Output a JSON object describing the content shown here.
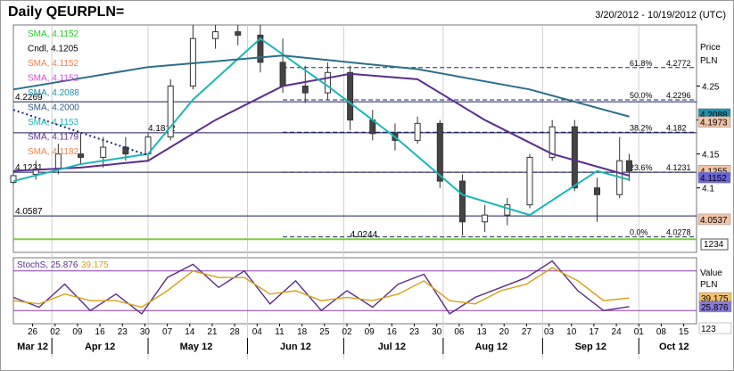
{
  "header": {
    "title": "Daily QEURPLN=",
    "date_range": "3/20/2012 - 10/19/2012 (UTC)"
  },
  "chart_data": [
    {
      "type": "line",
      "title": "Daily QEURPLN=",
      "y_axis": {
        "title": "Price",
        "unit": "PLN",
        "ticks": [
          4.25,
          4.2,
          4.15,
          4.1
        ],
        "range": [
          4.005,
          4.34
        ]
      },
      "x_axis": {
        "start": "2012-03-20",
        "end": "2012-10-19",
        "day_ticks": [
          "26",
          "02",
          "09",
          "16",
          "23",
          "30",
          "07",
          "14",
          "21",
          "28",
          "04",
          "11",
          "18",
          "25",
          "02",
          "09",
          "16",
          "23",
          "30",
          "06",
          "13",
          "20",
          "27",
          "03",
          "10",
          "17",
          "24",
          "01",
          "08",
          "15"
        ],
        "month_labels": [
          "Mar 12",
          "Apr 12",
          "May 12",
          "Jun 12",
          "Jul 12",
          "Aug 12",
          "Sep 12",
          "Oct 12"
        ]
      },
      "legend": [
        {
          "label": "SMA, 4.1152",
          "color": "#22c722"
        },
        {
          "label": "Cndl, 4.1205",
          "color": "#000000"
        },
        {
          "label": "SMA, 4.1152",
          "color": "#e8864f"
        },
        {
          "label": "SMA, 4.1152",
          "color": "#d14ad1"
        },
        {
          "label": "SMA, 4.2088",
          "color": "#1f8fa8"
        },
        {
          "label": "SMA, 4.2000",
          "color": "#2a5a86"
        },
        {
          "label": "SMA, 4.1153",
          "color": "#1ab6b6"
        },
        {
          "label": "SMA, 4.1179",
          "color": "#5a2e8a"
        },
        {
          "label": "SMA, 4.1182",
          "color": "#e8864f"
        }
      ],
      "fibonacci": [
        {
          "label": "61.8%",
          "value": "4.2772"
        },
        {
          "label": "50.0%",
          "value": "4.2296"
        },
        {
          "label": "38.2%",
          "value": "4.182"
        },
        {
          "label": "23.6%",
          "value": "4.1231"
        },
        {
          "label": "0.0%",
          "value": "4.0278"
        }
      ],
      "horizontal_levels": [
        {
          "label": "4.2269",
          "value": 4.2269
        },
        {
          "label": "4.1812",
          "value": 4.1812
        },
        {
          "label": "4.1231",
          "value": 4.1231
        },
        {
          "label": "4.0587",
          "value": 4.0587
        },
        {
          "label": "4.0244",
          "value": 4.0244
        }
      ],
      "price_flags": [
        {
          "label": "4.2088",
          "color": "#1f8fa8"
        },
        {
          "label": "4.1973",
          "color": "#f2c4a8"
        },
        {
          "label": "4.1255",
          "color": "#f2c4a8"
        },
        {
          "label": "4.1152",
          "color": "#6a64d8"
        },
        {
          "label": "4.0537",
          "color": "#f2c4a8"
        }
      ],
      "ohlc": [
        {
          "date": "2012-03-20",
          "o": 4.108,
          "h": 4.125,
          "l": 4.105,
          "c": 4.118
        },
        {
          "date": "2012-03-27",
          "o": 4.12,
          "h": 4.14,
          "l": 4.112,
          "c": 4.128
        },
        {
          "date": "2012-04-03",
          "o": 4.128,
          "h": 4.165,
          "l": 4.12,
          "c": 4.15
        },
        {
          "date": "2012-04-10",
          "o": 4.15,
          "h": 4.18,
          "l": 4.135,
          "c": 4.145
        },
        {
          "date": "2012-04-17",
          "o": 4.145,
          "h": 4.175,
          "l": 4.13,
          "c": 4.16
        },
        {
          "date": "2012-04-24",
          "o": 4.16,
          "h": 4.175,
          "l": 4.14,
          "c": 4.15
        },
        {
          "date": "2012-05-01",
          "o": 4.15,
          "h": 4.18,
          "l": 4.14,
          "c": 4.175
        },
        {
          "date": "2012-05-08",
          "o": 4.175,
          "h": 4.26,
          "l": 4.17,
          "c": 4.25
        },
        {
          "date": "2012-05-15",
          "o": 4.25,
          "h": 4.34,
          "l": 4.245,
          "c": 4.32
        },
        {
          "date": "2012-05-22",
          "o": 4.32,
          "h": 4.34,
          "l": 4.305,
          "c": 4.33
        },
        {
          "date": "2012-05-29",
          "o": 4.33,
          "h": 4.34,
          "l": 4.31,
          "c": 4.325
        },
        {
          "date": "2012-06-05",
          "o": 4.325,
          "h": 4.34,
          "l": 4.27,
          "c": 4.285
        },
        {
          "date": "2012-06-12",
          "o": 4.285,
          "h": 4.32,
          "l": 4.24,
          "c": 4.25
        },
        {
          "date": "2012-06-19",
          "o": 4.25,
          "h": 4.28,
          "l": 4.225,
          "c": 4.24
        },
        {
          "date": "2012-06-26",
          "o": 4.24,
          "h": 4.285,
          "l": 4.23,
          "c": 4.27
        },
        {
          "date": "2012-07-03",
          "o": 4.27,
          "h": 4.28,
          "l": 4.185,
          "c": 4.2
        },
        {
          "date": "2012-07-10",
          "o": 4.2,
          "h": 4.215,
          "l": 4.17,
          "c": 4.18
        },
        {
          "date": "2012-07-17",
          "o": 4.18,
          "h": 4.195,
          "l": 4.155,
          "c": 4.17
        },
        {
          "date": "2012-07-24",
          "o": 4.17,
          "h": 4.205,
          "l": 4.165,
          "c": 4.195
        },
        {
          "date": "2012-07-31",
          "o": 4.195,
          "h": 4.2,
          "l": 4.1,
          "c": 4.11
        },
        {
          "date": "2012-08-07",
          "o": 4.11,
          "h": 4.12,
          "l": 4.03,
          "c": 4.05
        },
        {
          "date": "2012-08-14",
          "o": 4.05,
          "h": 4.075,
          "l": 4.035,
          "c": 4.06
        },
        {
          "date": "2012-08-21",
          "o": 4.06,
          "h": 4.085,
          "l": 4.045,
          "c": 4.075
        },
        {
          "date": "2012-08-28",
          "o": 4.075,
          "h": 4.15,
          "l": 4.07,
          "c": 4.145
        },
        {
          "date": "2012-09-04",
          "o": 4.145,
          "h": 4.2,
          "l": 4.14,
          "c": 4.19
        },
        {
          "date": "2012-09-11",
          "o": 4.19,
          "h": 4.2,
          "l": 4.095,
          "c": 4.1
        },
        {
          "date": "2012-09-18",
          "o": 4.1,
          "h": 4.115,
          "l": 4.05,
          "c": 4.09
        },
        {
          "date": "2012-09-25",
          "o": 4.09,
          "h": 4.175,
          "l": 4.085,
          "c": 4.14
        },
        {
          "date": "2012-09-28",
          "o": 4.14,
          "h": 4.15,
          "l": 4.11,
          "c": 4.125
        }
      ],
      "series": [
        {
          "name": "SMA 4.1152",
          "color": "#5a2e8a",
          "x": [
            "2012-03-20",
            "2012-04-10",
            "2012-05-01",
            "2012-05-22",
            "2012-06-12",
            "2012-07-03",
            "2012-07-24",
            "2012-08-14",
            "2012-09-04",
            "2012-09-28"
          ],
          "values": [
            4.125,
            4.13,
            4.14,
            4.2,
            4.25,
            4.268,
            4.26,
            4.2,
            4.15,
            4.118
          ]
        },
        {
          "name": "SMA 4.1153",
          "color": "#1ab6b6",
          "x": [
            "2012-03-20",
            "2012-04-10",
            "2012-05-01",
            "2012-05-15",
            "2012-06-05",
            "2012-06-26",
            "2012-07-17",
            "2012-08-07",
            "2012-08-28",
            "2012-09-18",
            "2012-09-28"
          ],
          "values": [
            4.11,
            4.135,
            4.15,
            4.23,
            4.32,
            4.25,
            4.175,
            4.09,
            4.06,
            4.125,
            4.112
          ]
        },
        {
          "name": "SMA 4.2088",
          "color": "#2a6f8a",
          "x": [
            "2012-03-20",
            "2012-05-01",
            "2012-06-12",
            "2012-07-24",
            "2012-08-28",
            "2012-09-28"
          ],
          "values": [
            4.245,
            4.278,
            4.295,
            4.275,
            4.245,
            4.205
          ]
        }
      ]
    },
    {
      "type": "line",
      "title": "StochS",
      "legend": [
        {
          "label": "StochS, 25.876",
          "color": "#5a2e8a"
        },
        {
          "label": "39.175",
          "color": "#d4a017"
        }
      ],
      "y_axis": {
        "title": "Value",
        "unit": "PLN",
        "range": [
          0,
          100
        ],
        "ticks": [],
        "reference_lines": [
          80,
          20
        ]
      },
      "value_flags": [
        {
          "label": "39.175",
          "color": "#f2c070"
        },
        {
          "label": "25.876",
          "color": "#8a7ad8"
        },
        {
          "label": "123",
          "color": "#ffffff"
        }
      ],
      "series": [
        {
          "name": "StochS",
          "color": "#5a2e8a",
          "x": [
            "2012-03-20",
            "2012-03-28",
            "2012-04-05",
            "2012-04-13",
            "2012-04-21",
            "2012-04-29",
            "2012-05-07",
            "2012-05-15",
            "2012-05-23",
            "2012-05-31",
            "2012-06-08",
            "2012-06-16",
            "2012-06-24",
            "2012-07-02",
            "2012-07-10",
            "2012-07-18",
            "2012-07-26",
            "2012-08-03",
            "2012-08-11",
            "2012-08-19",
            "2012-08-27",
            "2012-09-04",
            "2012-09-12",
            "2012-09-20",
            "2012-09-28"
          ],
          "values": [
            40,
            25,
            60,
            20,
            45,
            15,
            70,
            90,
            55,
            80,
            30,
            65,
            20,
            50,
            25,
            60,
            75,
            15,
            40,
            55,
            70,
            95,
            50,
            20,
            26
          ]
        },
        {
          "name": "Signal",
          "color": "#d4a017",
          "x": [
            "2012-03-20",
            "2012-03-28",
            "2012-04-05",
            "2012-04-13",
            "2012-04-21",
            "2012-04-29",
            "2012-05-07",
            "2012-05-15",
            "2012-05-23",
            "2012-05-31",
            "2012-06-08",
            "2012-06-16",
            "2012-06-24",
            "2012-07-02",
            "2012-07-10",
            "2012-07-18",
            "2012-07-26",
            "2012-08-03",
            "2012-08-11",
            "2012-08-19",
            "2012-08-27",
            "2012-09-04",
            "2012-09-12",
            "2012-09-20",
            "2012-09-28"
          ],
          "values": [
            35,
            30,
            45,
            35,
            35,
            25,
            50,
            80,
            70,
            70,
            45,
            50,
            35,
            40,
            35,
            45,
            65,
            35,
            30,
            50,
            60,
            85,
            65,
            35,
            39
          ]
        }
      ]
    }
  ]
}
